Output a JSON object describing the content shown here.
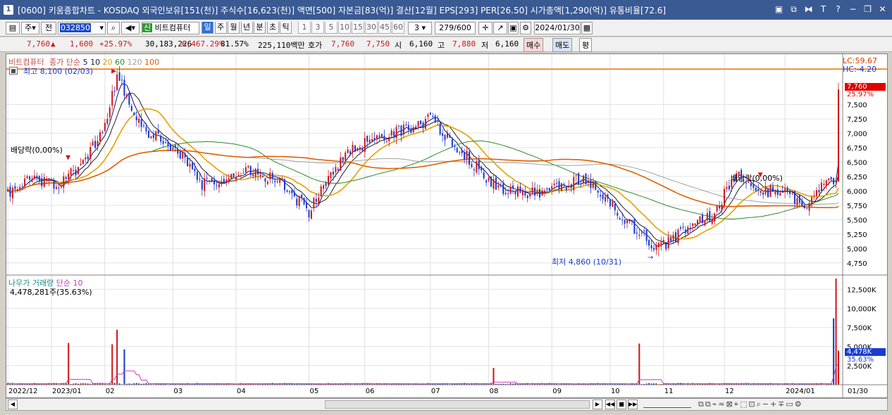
{
  "window": {
    "number": "1",
    "title": "[0600] 키움종합차트 - KOSDAQ 외국인보유[151(천)] 주식수[16,623(천)] 액면[500] 자본금[83(억)] 결산[12월] EPS[293] PER[26.50] 시가총액[1,290(억)] 유통비율[72.6]"
  },
  "toolbar": {
    "period_type": "주",
    "prev_btn": "전",
    "code": "032850",
    "name": "비트컴퓨터",
    "name_badge": "신",
    "periods": [
      "일",
      "주",
      "월",
      "년",
      "분",
      "초",
      "틱"
    ],
    "active_period": "일",
    "intervals": [
      "1",
      "3",
      "5",
      "10",
      "15",
      "30",
      "45",
      "60"
    ],
    "interval_value": "3",
    "count": "279",
    "count_total": "/600",
    "date": "2024/01/30"
  },
  "quote": {
    "price": "7,760",
    "arrow": "▲",
    "change": "1,600",
    "change_pct": "+25.97%",
    "volume": "30,183,226",
    "vol_ratio": "6,467.29%",
    "turnover": "81.57%",
    "amount": "225,110백만",
    "bid_label": "호가",
    "ask": "7,760",
    "bid": "7,750",
    "open_label": "시",
    "open": "6,160",
    "high_label": "고",
    "high": "7,880",
    "low_label": "저",
    "low": "6,160",
    "buy_btn": "매수",
    "sell_btn": "매도",
    "avg_btn": "평"
  },
  "price_pane": {
    "legend_name": "비트컴퓨터",
    "legend_ma": "종가 단순",
    "ma_periods": [
      "5",
      "10",
      "20",
      "60",
      "120",
      "100"
    ],
    "hi_label": "최고 8,100 (02/03)",
    "lo_label": "최저 4,860 (10/31)",
    "div1": "배당락(0,00%)",
    "div2": "배당락(0,00%)",
    "lc": "LC:59.67",
    "hc": "HC:-4.20",
    "price_tag": "7,760",
    "pct_tag": "25.97%"
  },
  "volume_pane": {
    "legend": "나무가 거래량",
    "legend_ma": "단순 10",
    "cur_label": "4,478,281주(35.63%)",
    "tag1": "4,478K",
    "tag2": "35.63%"
  },
  "colors": {
    "up": "#d01818",
    "down": "#1a3ccf",
    "ma5": "#101080",
    "ma10": "#202020",
    "ma20": "#e8a000",
    "ma60": "#2a8a2a",
    "ma120": "#a0a0a0",
    "ma100": "#e06000",
    "ref": "#f07000",
    "vol_ma": "#c040c0",
    "title_bg": "#3a5a94"
  },
  "chart_data": {
    "type": "candlestick",
    "ylim": [
      4650,
      8250
    ],
    "y_ticks": [
      "4,750",
      "5,000",
      "5,250",
      "5,500",
      "5,750",
      "6,000",
      "6,250",
      "6,500",
      "6,750",
      "7,000",
      "7,250",
      "7,500"
    ],
    "y_tick_values": [
      4750,
      5000,
      5250,
      5500,
      5750,
      6000,
      6250,
      6500,
      6750,
      7000,
      7250,
      7500
    ],
    "vol_ylim": [
      0,
      14000
    ],
    "vol_ticks": [
      "2,500K",
      "5,000K",
      "7,500K",
      "10,000K",
      "12,500K"
    ],
    "vol_tick_values": [
      2500,
      5000,
      7500,
      10000,
      12500
    ],
    "x_labels": [
      "2022/12",
      "2023/01",
      "02",
      "03",
      "04",
      "05",
      "06",
      "07",
      "08",
      "09",
      "10",
      "11",
      "12",
      "2024/01",
      "01/30"
    ],
    "x_label_days": [
      0,
      18,
      40,
      68,
      94,
      124,
      147,
      174,
      198,
      224,
      248,
      270,
      295,
      320,
      342
    ],
    "n_days": 342,
    "ref_line": 8100,
    "high_point": {
      "day": 45,
      "value": 8100
    },
    "low_point": {
      "day": 268,
      "value": 4860
    },
    "last": {
      "price": 7760,
      "volume": 4478
    }
  }
}
